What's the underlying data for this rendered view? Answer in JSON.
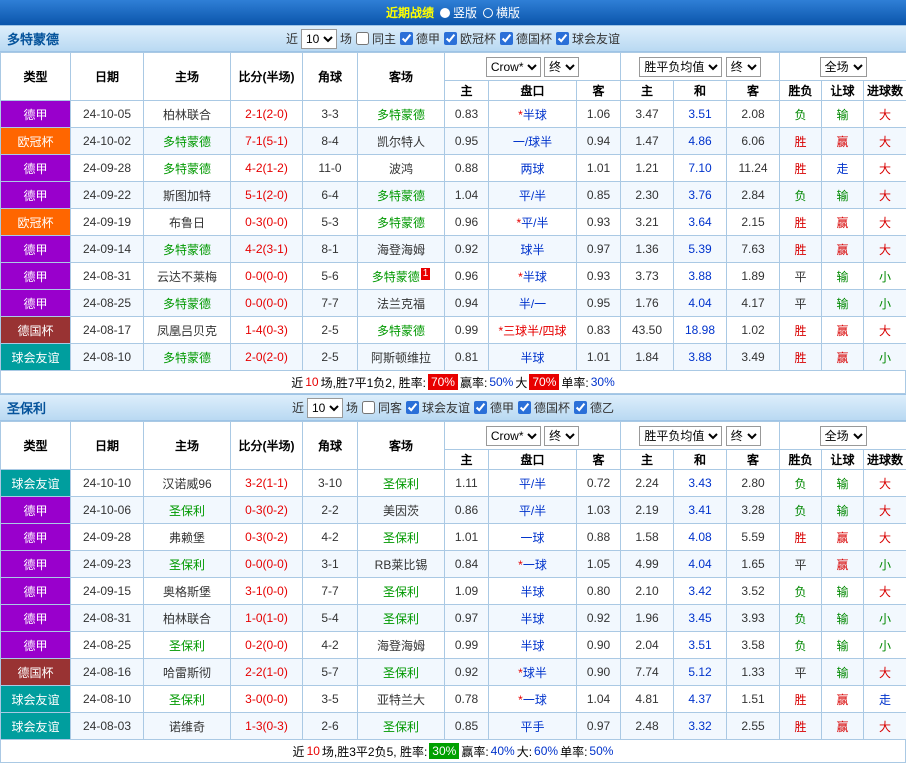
{
  "topbar": {
    "title": "近期战绩",
    "options": [
      {
        "label": "竖版",
        "selected": true
      },
      {
        "label": "横版",
        "selected": false
      }
    ]
  },
  "columns": {
    "main": [
      "类型",
      "日期",
      "主场",
      "比分(半场)",
      "角球",
      "客场"
    ],
    "sub": [
      "主",
      "盘口",
      "客",
      "主",
      "和",
      "客",
      "胜负",
      "让球",
      "进球数"
    ]
  },
  "badge_colors": {
    "德甲": "#9900cc",
    "欧冠杯": "#ff6600",
    "德国杯": "#993333",
    "球会友谊": "#009e9e",
    "德乙": "#336699"
  },
  "result_colors": {
    "胜": "#d80000",
    "平": "#333333",
    "负": "#008800"
  },
  "let_colors": {
    "赢": "#d80000",
    "输": "#008800",
    "走": "#0033cc"
  },
  "goal_colors": {
    "大": "#d80000",
    "小": "#008800",
    "走": "#0033cc"
  },
  "colors": {
    "score": "#e60000",
    "focus_team": "#009900",
    "other_team": "#333333",
    "handicap": "#0033cc",
    "handicap_red": "#e60000",
    "avg_draw": "#0033cc"
  },
  "sections": [
    {
      "team": "多特蒙德",
      "filter": {
        "near": "近",
        "count": "10",
        "games": "场",
        "same": "同主",
        "same_checked": false,
        "leagues": [
          "德甲",
          "欧冠杯",
          "德国杯",
          "球会友谊"
        ]
      },
      "selects": [
        "Crow*",
        "终",
        "胜平负均值",
        "终",
        "全场"
      ],
      "rows": [
        {
          "type": "德甲",
          "date": "24-10-05",
          "home": "柏林联合",
          "score": "2-1(2-0)",
          "corner": "3-3",
          "away": "多特蒙德",
          "card": "",
          "o1": "0.83",
          "pk": "*半球",
          "pk_red": false,
          "o2": "1.06",
          "m1": "3.47",
          "m2": "3.51",
          "m3": "2.08",
          "res": "负",
          "let": "输",
          "goal": "大"
        },
        {
          "type": "欧冠杯",
          "date": "24-10-02",
          "home": "多特蒙德",
          "score": "7-1(5-1)",
          "corner": "8-4",
          "away": "凯尔特人",
          "card": "",
          "o1": "0.95",
          "pk": "一/球半",
          "pk_red": false,
          "o2": "0.94",
          "m1": "1.47",
          "m2": "4.86",
          "m3": "6.06",
          "res": "胜",
          "let": "赢",
          "goal": "大"
        },
        {
          "type": "德甲",
          "date": "24-09-28",
          "home": "多特蒙德",
          "score": "4-2(1-2)",
          "corner": "11-0",
          "away": "波鸿",
          "card": "",
          "o1": "0.88",
          "pk": "两球",
          "pk_red": false,
          "o2": "1.01",
          "m1": "1.21",
          "m2": "7.10",
          "m3": "11.24",
          "res": "胜",
          "let": "走",
          "goal": "大"
        },
        {
          "type": "德甲",
          "date": "24-09-22",
          "home": "斯图加特",
          "score": "5-1(2-0)",
          "corner": "6-4",
          "away": "多特蒙德",
          "card": "",
          "o1": "1.04",
          "pk": "平/半",
          "pk_red": false,
          "o2": "0.85",
          "m1": "2.30",
          "m2": "3.76",
          "m3": "2.84",
          "res": "负",
          "let": "输",
          "goal": "大"
        },
        {
          "type": "欧冠杯",
          "date": "24-09-19",
          "home": "布鲁日",
          "score": "0-3(0-0)",
          "corner": "5-3",
          "away": "多特蒙德",
          "card": "",
          "o1": "0.96",
          "pk": "*平/半",
          "pk_red": false,
          "o2": "0.93",
          "m1": "3.21",
          "m2": "3.64",
          "m3": "2.15",
          "res": "胜",
          "let": "赢",
          "goal": "大"
        },
        {
          "type": "德甲",
          "date": "24-09-14",
          "home": "多特蒙德",
          "score": "4-2(3-1)",
          "corner": "8-1",
          "away": "海登海姆",
          "card": "",
          "o1": "0.92",
          "pk": "球半",
          "pk_red": false,
          "o2": "0.97",
          "m1": "1.36",
          "m2": "5.39",
          "m3": "7.63",
          "res": "胜",
          "let": "赢",
          "goal": "大"
        },
        {
          "type": "德甲",
          "date": "24-08-31",
          "home": "云达不莱梅",
          "score": "0-0(0-0)",
          "corner": "5-6",
          "away": "多特蒙德",
          "card": "1",
          "o1": "0.96",
          "pk": "*半球",
          "pk_red": false,
          "o2": "0.93",
          "m1": "3.73",
          "m2": "3.88",
          "m3": "1.89",
          "res": "平",
          "let": "输",
          "goal": "小"
        },
        {
          "type": "德甲",
          "date": "24-08-25",
          "home": "多特蒙德",
          "score": "0-0(0-0)",
          "corner": "7-7",
          "away": "法兰克福",
          "card": "",
          "o1": "0.94",
          "pk": "半/一",
          "pk_red": false,
          "o2": "0.95",
          "m1": "1.76",
          "m2": "4.04",
          "m3": "4.17",
          "res": "平",
          "let": "输",
          "goal": "小"
        },
        {
          "type": "德国杯",
          "date": "24-08-17",
          "home": "凤凰吕贝克",
          "score": "1-4(0-3)",
          "corner": "2-5",
          "away": "多特蒙德",
          "card": "",
          "o1": "0.99",
          "pk": "*三球半/四球",
          "pk_red": true,
          "o2": "0.83",
          "m1": "43.50",
          "m2": "18.98",
          "m3": "1.02",
          "res": "胜",
          "let": "赢",
          "goal": "大"
        },
        {
          "type": "球会友谊",
          "date": "24-08-10",
          "home": "多特蒙德",
          "score": "2-0(2-0)",
          "corner": "2-5",
          "away": "阿斯顿维拉",
          "card": "",
          "o1": "0.81",
          "pk": "半球",
          "pk_red": false,
          "o2": "1.01",
          "m1": "1.84",
          "m2": "3.88",
          "m3": "3.49",
          "res": "胜",
          "let": "赢",
          "goal": "小"
        }
      ],
      "footer": [
        {
          "t": "近"
        },
        {
          "t": "10",
          "s": "red"
        },
        {
          "t": "场,胜7平1负2, 胜率: "
        },
        {
          "t": "70%",
          "s": "badge-red"
        },
        {
          "t": " 赢率:"
        },
        {
          "t": "50%",
          "s": "blue"
        },
        {
          "t": " 大 "
        },
        {
          "t": "70%",
          "s": "badge-red"
        },
        {
          "t": " 单率:"
        },
        {
          "t": "30%",
          "s": "blue"
        }
      ]
    },
    {
      "team": "圣保利",
      "filter": {
        "near": "近",
        "count": "10",
        "games": "场",
        "same": "同客",
        "same_checked": false,
        "leagues": [
          "球会友谊",
          "德甲",
          "德国杯",
          "德乙"
        ]
      },
      "selects": [
        "Crow*",
        "终",
        "胜平负均值",
        "终",
        "全场"
      ],
      "rows": [
        {
          "type": "球会友谊",
          "date": "24-10-10",
          "home": "汉诺威96",
          "score": "3-2(1-1)",
          "corner": "3-10",
          "away": "圣保利",
          "card": "",
          "o1": "1.11",
          "pk": "平/半",
          "pk_red": false,
          "o2": "0.72",
          "m1": "2.24",
          "m2": "3.43",
          "m3": "2.80",
          "res": "负",
          "let": "输",
          "goal": "大"
        },
        {
          "type": "德甲",
          "date": "24-10-06",
          "home": "圣保利",
          "score": "0-3(0-2)",
          "corner": "2-2",
          "away": "美因茨",
          "card": "",
          "o1": "0.86",
          "pk": "平/半",
          "pk_red": false,
          "o2": "1.03",
          "m1": "2.19",
          "m2": "3.41",
          "m3": "3.28",
          "res": "负",
          "let": "输",
          "goal": "大"
        },
        {
          "type": "德甲",
          "date": "24-09-28",
          "home": "弗赖堡",
          "score": "0-3(0-2)",
          "corner": "4-2",
          "away": "圣保利",
          "card": "",
          "o1": "1.01",
          "pk": "一球",
          "pk_red": false,
          "o2": "0.88",
          "m1": "1.58",
          "m2": "4.08",
          "m3": "5.59",
          "res": "胜",
          "let": "赢",
          "goal": "大"
        },
        {
          "type": "德甲",
          "date": "24-09-23",
          "home": "圣保利",
          "score": "0-0(0-0)",
          "corner": "3-1",
          "away": "RB莱比锡",
          "card": "",
          "o1": "0.84",
          "pk": "*一球",
          "pk_red": false,
          "o2": "1.05",
          "m1": "4.99",
          "m2": "4.04",
          "m3": "1.65",
          "res": "平",
          "let": "赢",
          "goal": "小"
        },
        {
          "type": "德甲",
          "date": "24-09-15",
          "home": "奥格斯堡",
          "score": "3-1(0-0)",
          "corner": "7-7",
          "away": "圣保利",
          "card": "",
          "o1": "1.09",
          "pk": "半球",
          "pk_red": false,
          "o2": "0.80",
          "m1": "2.10",
          "m2": "3.42",
          "m3": "3.52",
          "res": "负",
          "let": "输",
          "goal": "大"
        },
        {
          "type": "德甲",
          "date": "24-08-31",
          "home": "柏林联合",
          "score": "1-0(1-0)",
          "corner": "5-4",
          "away": "圣保利",
          "card": "",
          "o1": "0.97",
          "pk": "半球",
          "pk_red": false,
          "o2": "0.92",
          "m1": "1.96",
          "m2": "3.45",
          "m3": "3.93",
          "res": "负",
          "let": "输",
          "goal": "小"
        },
        {
          "type": "德甲",
          "date": "24-08-25",
          "home": "圣保利",
          "score": "0-2(0-0)",
          "corner": "4-2",
          "away": "海登海姆",
          "card": "",
          "o1": "0.99",
          "pk": "半球",
          "pk_red": false,
          "o2": "0.90",
          "m1": "2.04",
          "m2": "3.51",
          "m3": "3.58",
          "res": "负",
          "let": "输",
          "goal": "小"
        },
        {
          "type": "德国杯",
          "date": "24-08-16",
          "home": "哈雷斯彻",
          "score": "2-2(1-0)",
          "corner": "5-7",
          "away": "圣保利",
          "card": "",
          "o1": "0.92",
          "pk": "*球半",
          "pk_red": false,
          "o2": "0.90",
          "m1": "7.74",
          "m2": "5.12",
          "m3": "1.33",
          "res": "平",
          "let": "输",
          "goal": "大"
        },
        {
          "type": "球会友谊",
          "date": "24-08-10",
          "home": "圣保利",
          "score": "3-0(0-0)",
          "corner": "3-5",
          "away": "亚特兰大",
          "card": "",
          "o1": "0.78",
          "pk": "*一球",
          "pk_red": false,
          "o2": "1.04",
          "m1": "4.81",
          "m2": "4.37",
          "m3": "1.51",
          "res": "胜",
          "let": "赢",
          "goal": "走"
        },
        {
          "type": "球会友谊",
          "date": "24-08-03",
          "home": "诺维奇",
          "score": "1-3(0-3)",
          "corner": "2-6",
          "away": "圣保利",
          "card": "",
          "o1": "0.85",
          "pk": "平手",
          "pk_red": false,
          "o2": "0.97",
          "m1": "2.48",
          "m2": "3.32",
          "m3": "2.55",
          "res": "胜",
          "let": "赢",
          "goal": "大"
        }
      ],
      "footer": [
        {
          "t": "近"
        },
        {
          "t": "10",
          "s": "red"
        },
        {
          "t": "场,胜3平2负5, 胜率: "
        },
        {
          "t": "30%",
          "s": "badge-green"
        },
        {
          "t": " 赢率:"
        },
        {
          "t": "40%",
          "s": "blue"
        },
        {
          "t": " 大:"
        },
        {
          "t": "60%",
          "s": "blue"
        },
        {
          "t": " 单率:"
        },
        {
          "t": "50%",
          "s": "blue"
        }
      ]
    }
  ]
}
